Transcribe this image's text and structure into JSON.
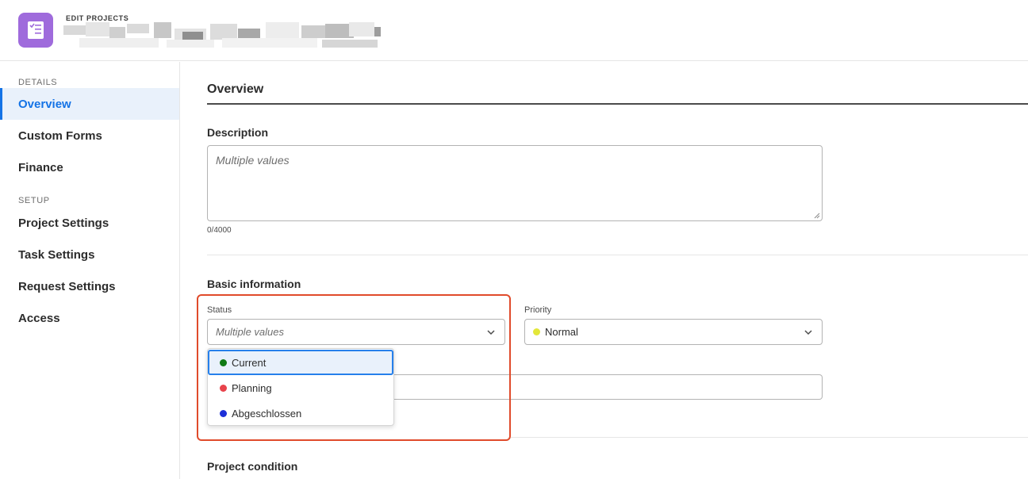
{
  "header": {
    "eyebrow": "EDIT PROJECTS",
    "app_icon": "edit-projects-app-icon",
    "accent_color": "#9f6bdc"
  },
  "sidebar": {
    "sections": [
      {
        "title": "DETAILS",
        "items": [
          {
            "label": "Overview",
            "active": true
          },
          {
            "label": "Custom Forms",
            "active": false
          },
          {
            "label": "Finance",
            "active": false
          }
        ]
      },
      {
        "title": "SETUP",
        "items": [
          {
            "label": "Project Settings",
            "active": false
          },
          {
            "label": "Task Settings",
            "active": false
          },
          {
            "label": "Request Settings",
            "active": false
          },
          {
            "label": "Access",
            "active": false
          }
        ]
      }
    ],
    "active_color": "#1473e6"
  },
  "main": {
    "title": "Overview",
    "description": {
      "label": "Description",
      "placeholder": "Multiple values",
      "counter": "0/4000"
    },
    "basic_info": {
      "title": "Basic information",
      "status": {
        "label": "Status",
        "placeholder": "Multiple values",
        "options": [
          {
            "label": "Current",
            "color": "#0f7a14",
            "focused": true
          },
          {
            "label": "Planning",
            "color": "#e8434b",
            "focused": false
          },
          {
            "label": "Abgeschlossen",
            "color": "#1c2fd8",
            "focused": false
          }
        ]
      },
      "priority": {
        "label": "Priority",
        "value": "Normal",
        "color": "#e3e73a"
      }
    },
    "project_condition": {
      "title": "Project condition"
    },
    "highlight_color": "#e04b2b"
  }
}
